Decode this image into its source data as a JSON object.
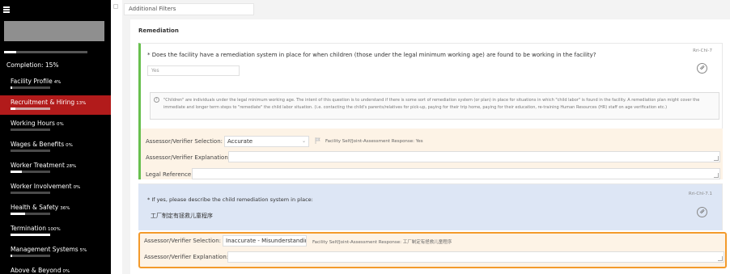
{
  "sidebar": {
    "completion_label": "Completion: 15%",
    "completion_value": 0.15,
    "items": [
      {
        "label": "Facility Profile",
        "pct": "4%",
        "value": 0.04,
        "active": false
      },
      {
        "label": "Recruitment & Hiring",
        "pct": "13%",
        "value": 0.13,
        "active": true
      },
      {
        "label": "Working Hours",
        "pct": "0%",
        "value": 0,
        "active": false
      },
      {
        "label": "Wages & Benefits",
        "pct": "0%",
        "value": 0,
        "active": false
      },
      {
        "label": "Worker Treatment",
        "pct": "28%",
        "value": 0.28,
        "active": false
      },
      {
        "label": "Worker Involvement",
        "pct": "0%",
        "value": 0,
        "active": false
      },
      {
        "label": "Health & Safety",
        "pct": "36%",
        "value": 0.36,
        "active": false
      },
      {
        "label": "Termination",
        "pct": "100%",
        "value": 1.0,
        "active": false
      },
      {
        "label": "Management Systems",
        "pct": "5%",
        "value": 0.05,
        "active": false
      },
      {
        "label": "Above & Beyond",
        "pct": "0%",
        "value": 0,
        "active": false
      }
    ]
  },
  "filters": {
    "label": "Additional Filters"
  },
  "section": {
    "title": "Remediation"
  },
  "question1": {
    "text": "* Does the facility have a remediation system in place for when children (those under the legal minimum working age) are found to be working in the facility?",
    "id": "Rri-Chl-7",
    "answer": "Yes",
    "info": "\"Children\" are individuals under the legal minimum working age. The intent of this question is to understand if there is some sort of remediation system (or plan) in place for situations in which \"child labor\" is found in the facility. A remediation plan might cover the immediate and longer term steps to \"remediate\" the child labor situation. (i.e. contacting the child's parents/relatives for pick-up, paying for their trip home, paying for their education, re-training Human Resources (HR) staff on age verification etc.)",
    "selection_label": "Assessor/Verifier Selection:",
    "selection_value": "Accurate",
    "self_response": "Facility Self/Joint-Assessment Response:  Yes",
    "explanation_label": "Assessor/Verifier Explanation:",
    "legal_label": "Legal Reference:"
  },
  "question2": {
    "text": "* If yes, please describe the child remediation system in place:",
    "id": "Rri-Chl-7.1",
    "answer": "工厂制定有拯救儿童程序",
    "selection_label": "Assessor/Verifier Selection:",
    "selection_value": "Inaccurate - Misunderstanding",
    "self_response": "Facility Self/Joint-Assessment Response:  工厂制定有拯救儿童程序",
    "explanation_label": "Assessor/Verifier Explanation:"
  },
  "colors": {
    "sidebar_bg": "#000000",
    "active": "#b21b1b",
    "green_accent": "#69c04f",
    "highlight": "#f39a2b",
    "blue_card": "#dde6f5",
    "assess_bg": "#fdf3e6"
  }
}
